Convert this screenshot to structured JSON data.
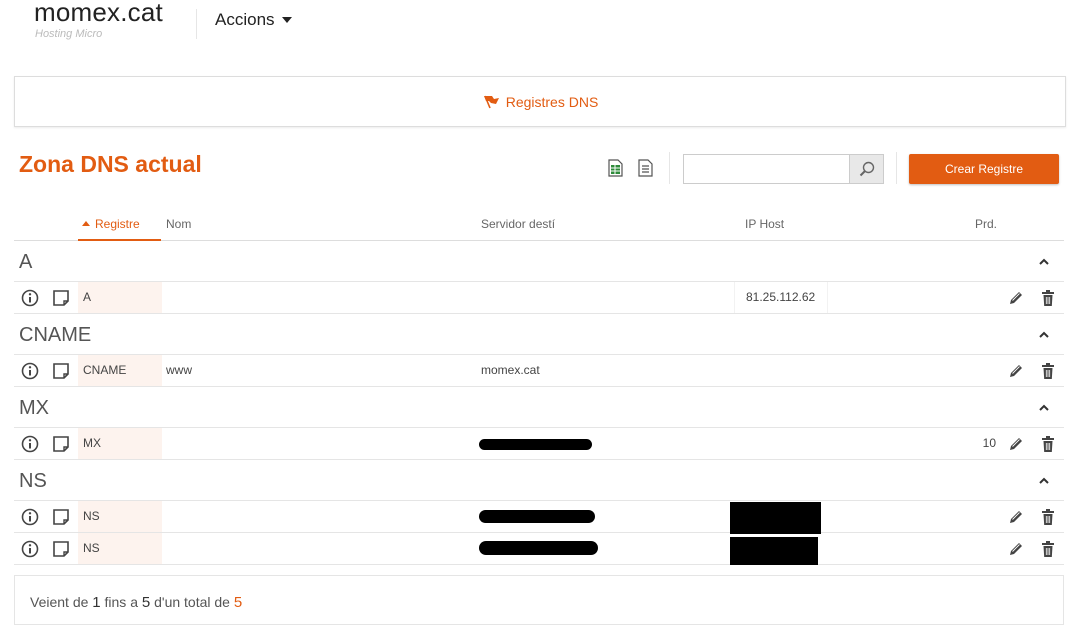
{
  "header": {
    "brand": "momex.cat",
    "tagline": "Hosting Micro",
    "actions_label": "Accions"
  },
  "tabs": {
    "active": "Registres DNS"
  },
  "toolbar": {
    "title": "Zona DNS actual",
    "search_placeholder": "",
    "create_label": "Crear Registre"
  },
  "table": {
    "columns": {
      "registre": "Registre",
      "nom": "Nom",
      "servidor": "Servidor destí",
      "ip": "IP Host",
      "prd": "Prd."
    },
    "groups": [
      {
        "name": "A",
        "rows": [
          {
            "type": "A",
            "nom": "",
            "dest": "",
            "ip": "81.25.112.62",
            "prd": ""
          }
        ]
      },
      {
        "name": "CNAME",
        "rows": [
          {
            "type": "CNAME",
            "nom": "www",
            "dest": "momex.cat",
            "ip": "",
            "prd": ""
          }
        ]
      },
      {
        "name": "MX",
        "rows": [
          {
            "type": "MX",
            "nom": "",
            "dest": "",
            "ip": "",
            "prd": "10"
          }
        ]
      },
      {
        "name": "NS",
        "rows": [
          {
            "type": "NS",
            "nom": "",
            "dest": "",
            "ip": "",
            "prd": ""
          },
          {
            "type": "NS",
            "nom": "",
            "dest": "",
            "ip": "",
            "prd": ""
          }
        ]
      }
    ]
  },
  "footer": {
    "prefix": "Veient de ",
    "from": "1",
    "mid1": " fins a ",
    "to": "5",
    "mid2": " d'un total de ",
    "total": "5"
  },
  "colors": {
    "accent": "#e25c12",
    "type_cell_bg": "#fdf3ee"
  },
  "icons": {
    "tab": "flag-icon",
    "export_excel": "excel-icon",
    "export_text": "document-icon",
    "search": "search-icon",
    "row_info": "info-icon",
    "row_note": "note-icon",
    "row_edit": "pencil-icon",
    "row_delete": "trash-icon",
    "group_collapse": "chevron-up-icon"
  }
}
